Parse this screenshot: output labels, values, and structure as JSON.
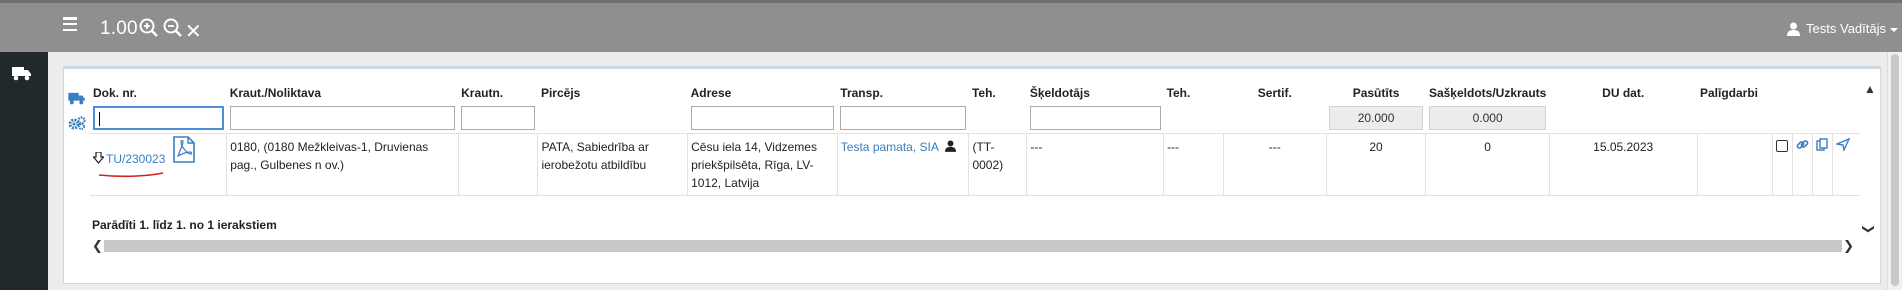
{
  "topbar": {
    "zoom_value": "1.00",
    "user_name": "Tests Vadītājs"
  },
  "table": {
    "headers": {
      "dok_nr": "Dok. nr.",
      "kraut_noliktava": "Kraut./Noliktava",
      "krautn": "Krautn.",
      "pircejs": "Pircējs",
      "adrese": "Adrese",
      "transp": "Transp.",
      "teh1": "Teh.",
      "skeldotajs": "Šķeldotājs",
      "teh2": "Teh.",
      "sertif": "Sertif.",
      "pasutits": "Pasūtīts",
      "saskeldots": "Sašķeldots/Uzkrauts",
      "du_dat": "DU dat.",
      "paligdarbi": "Palīgdarbi"
    },
    "filter_totals": {
      "pasutits": "20.000",
      "saskeldots": "0.000"
    },
    "row": {
      "dok_nr": "TU/230023",
      "kraut_noliktava": "0180, (0180 Mežkleivas-1, Druvienas pag., Gulbenes n ov.)",
      "krautn": "",
      "pircejs": "PATA, Sabiedrība ar ierobežotu atbildību",
      "adrese": "Cēsu iela 14, Vidzemes priekšpilsēta, Rīga, LV-1012, Latvija",
      "transp": "Testa pamata, SIA",
      "teh1": "(TT-0002)",
      "skeldotajs": "---",
      "teh2": "---",
      "sertif": "---",
      "pasutits": "20",
      "saskeldots": "0",
      "du_dat": "15.05.2023"
    },
    "footer_info": "Parādīti 1. līdz 1. no 1 ierakstiem"
  },
  "colors": {
    "topbar": "#8f8f8f",
    "sidebar": "#21292d",
    "link": "#3a7dc2",
    "focus": "#4d8fd6",
    "annotation": "#d62020"
  }
}
